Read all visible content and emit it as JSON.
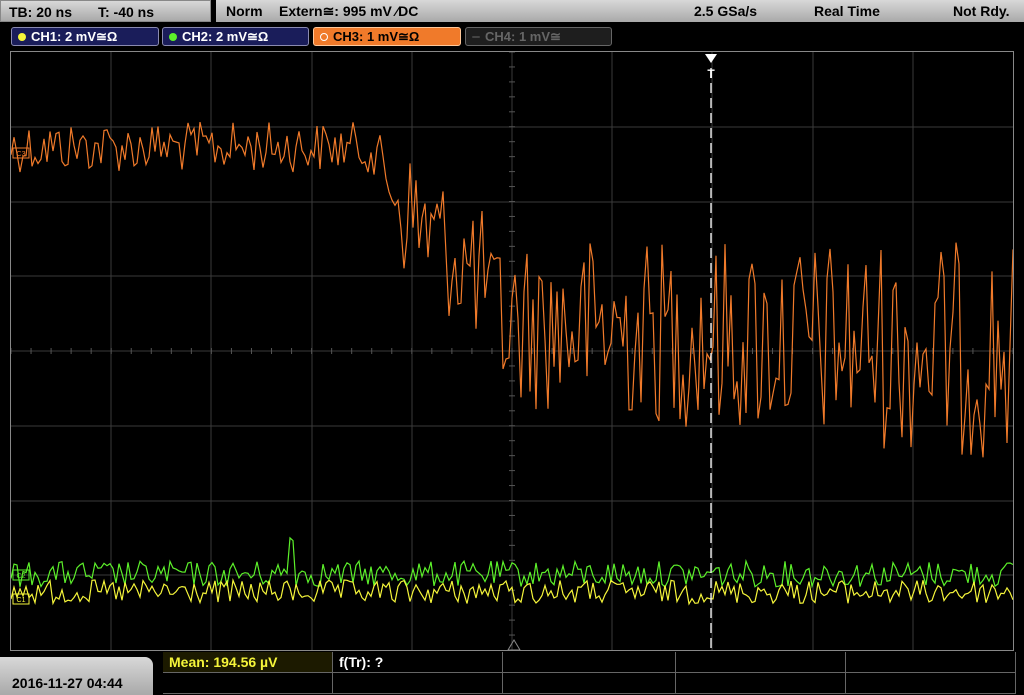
{
  "timebase": {
    "tb": "TB: 20 ns",
    "trigger_time": "T: -40 ns"
  },
  "status": {
    "mode": "Norm",
    "trigger": "Extern≅: 995 mV ⁄DC",
    "sample_rate": "2.5 GSa/s",
    "acquisition": "Real Time",
    "ready": "Not Rdy."
  },
  "channels": [
    {
      "label": "CH1: 2 mV≅Ω",
      "color": "#f5f53a",
      "active": true
    },
    {
      "label": "CH2: 2 mV≅Ω",
      "color": "#5cf02a",
      "active": true
    },
    {
      "label": "CH3: 1 mV≅Ω",
      "color": "#f07a2a",
      "active": true,
      "selected": true
    },
    {
      "label": "CH4: 1 mV≅",
      "color": "#666666",
      "active": false
    }
  ],
  "markers": {
    "ch3_ground": "C3",
    "ch2_ground": "C2",
    "ch1_ground": "C1",
    "trigger": "T"
  },
  "footer": {
    "datetime": "2016-11-27 04:44",
    "mean": "Mean: 194.56 µV",
    "rise_time": "f(Tr): ?"
  },
  "colors": {
    "grid": "#3a3a3a",
    "ch1": "#f5f53a",
    "ch2": "#5cf02a",
    "ch3": "#f07a2a"
  }
}
